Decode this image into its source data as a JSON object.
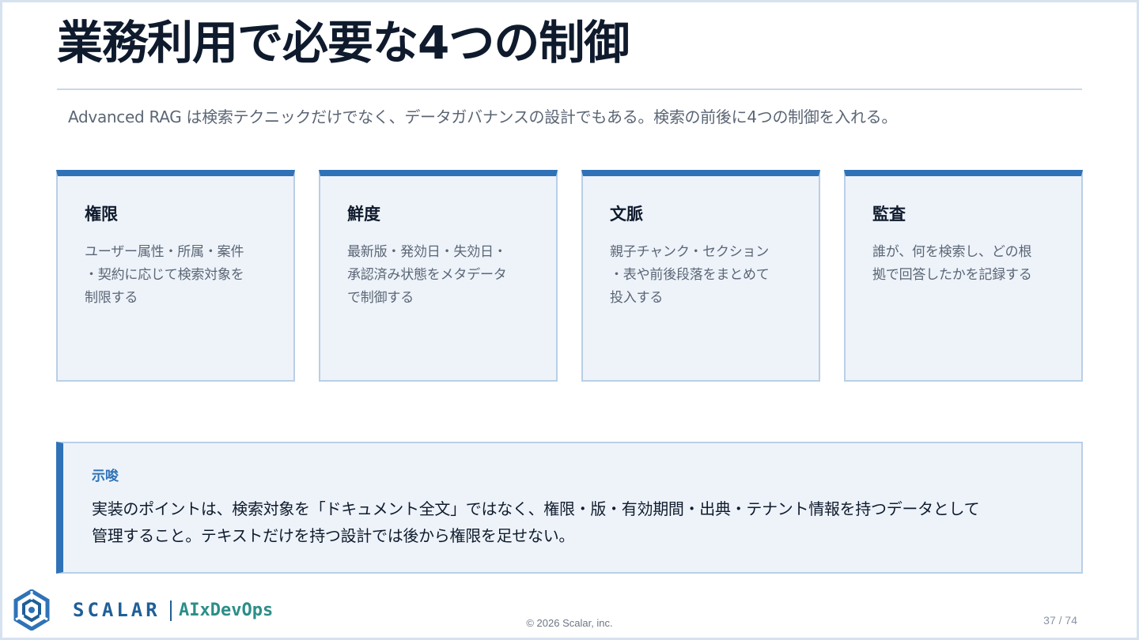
{
  "slide": {
    "title": "業務利用で必要な4つの制御",
    "subtitle": "Advanced RAG は検索テクニックだけでなく、データガバナンスの設計でもある。検索の前後に4つの制御を入れる。"
  },
  "cards": [
    {
      "title": "権限",
      "lines": [
        "ユーザー属性・所属・案件",
        "・契約に応じて検索対象を",
        "制限する"
      ]
    },
    {
      "title": "鮮度",
      "lines": [
        "最新版・発効日・失効日・",
        "承認済み状態をメタデータ",
        "で制御する"
      ]
    },
    {
      "title": "文脈",
      "lines": [
        "親子チャンク・セクション",
        "・表や前後段落をまとめて",
        "投入する"
      ]
    },
    {
      "title": "監査",
      "lines": [
        "誰が、何を検索し、どの根",
        "拠で回答したかを記録する"
      ]
    }
  ],
  "insight": {
    "label": "示唆",
    "lines": [
      "実装のポイントは、検索対象を「ドキュメント全文」ではなく、権限・版・有効期間・出典・テナント情報を持つデータとして",
      "管理すること。テキストだけを持つ設計では後から権限を足せない。"
    ]
  },
  "footer": {
    "brand": "SCALAR",
    "product": "AIxDevOps",
    "copyright": "© 2026 Scalar, inc.",
    "page": "37 / 74"
  },
  "icons": {
    "logo": "scalar-logo-icon"
  },
  "colors": {
    "accent": "#2f72b7",
    "card_bg": "#eef3fa",
    "card_border": "#b9cfe6",
    "brand": "#1f5f98",
    "product": "#2c8e88"
  }
}
